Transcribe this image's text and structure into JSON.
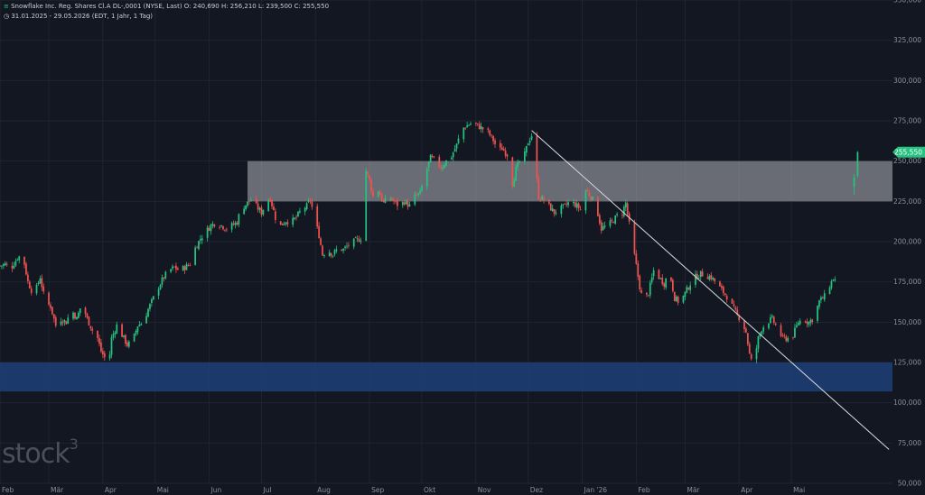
{
  "header": {
    "line1": "Snowflake Inc. Reg. Shares Cl.A DL-,0001 (NYSE, Last)",
    "ohlc": "O: 240,690   H: 256,210   L: 239,500   C: 255,550",
    "line2": "31.01.2025 - 29.05.2026   (EDT, 1 Jahr, 1 Tag)"
  },
  "watermark": {
    "text": "stock",
    "sup": "3"
  },
  "chart_data": {
    "type": "candlestick",
    "y_ticks": [
      50,
      75,
      100,
      125,
      150,
      175,
      200,
      225,
      250,
      275,
      300,
      325,
      350
    ],
    "y_tick_labels": [
      "50,000",
      "75,000",
      "100,000",
      "125,000",
      "150,000",
      "175,000",
      "200,000",
      "225,000",
      "250,000",
      "275,000",
      "300,000",
      "325,000",
      "350,000"
    ],
    "ylim": [
      50,
      350
    ],
    "x_labels": [
      "Feb",
      "Mär",
      "Apr",
      "Mai",
      "Jun",
      "Jul",
      "Aug",
      "Sep",
      "Okt",
      "Nov",
      "Dez",
      "Jan '26",
      "Feb",
      "Mär",
      "Apr",
      "Mai"
    ],
    "x_label_days": [
      0,
      28,
      59,
      89,
      120,
      150,
      181,
      212,
      242,
      273,
      303,
      334,
      365,
      393,
      424,
      454
    ],
    "x_range_days": [
      0,
      512
    ],
    "last_price_label": "255,550",
    "last_price": 255.55,
    "zones": [
      {
        "name": "resistance-zone",
        "from": 225,
        "to": 250,
        "start_day": 142,
        "color": "#b0b3b8"
      },
      {
        "name": "support-zone",
        "from": 107,
        "to": 125,
        "start_day": 0,
        "color": "#1e3f78"
      }
    ],
    "trendline": {
      "start_day": 305,
      "start_value": 269,
      "end_day": 510,
      "end_value": 71
    },
    "anchors": [
      [
        0,
        185
      ],
      [
        3,
        186
      ],
      [
        6,
        183
      ],
      [
        10,
        190
      ],
      [
        13,
        192
      ],
      [
        16,
        175
      ],
      [
        18,
        170
      ],
      [
        20,
        168
      ],
      [
        23,
        178
      ],
      [
        26,
        162
      ],
      [
        29,
        160
      ],
      [
        32,
        148
      ],
      [
        35,
        152
      ],
      [
        38,
        150
      ],
      [
        41,
        158
      ],
      [
        44,
        152
      ],
      [
        47,
        162
      ],
      [
        50,
        152
      ],
      [
        53,
        145
      ],
      [
        56,
        140
      ],
      [
        58,
        132
      ],
      [
        60,
        128
      ],
      [
        62,
        120
      ],
      [
        64,
        140
      ],
      [
        67,
        148
      ],
      [
        70,
        142
      ],
      [
        73,
        136
      ],
      [
        76,
        138
      ],
      [
        79,
        148
      ],
      [
        82,
        150
      ],
      [
        85,
        158
      ],
      [
        88,
        165
      ],
      [
        91,
        172
      ],
      [
        94,
        178
      ],
      [
        97,
        182
      ],
      [
        100,
        184
      ],
      [
        103,
        182
      ],
      [
        106,
        184
      ],
      [
        110,
        187
      ],
      [
        112,
        196
      ],
      [
        115,
        202
      ],
      [
        118,
        206
      ],
      [
        121,
        210
      ],
      [
        124,
        212
      ],
      [
        127,
        210
      ],
      [
        130,
        208
      ],
      [
        133,
        210
      ],
      [
        136,
        212
      ],
      [
        138,
        220
      ],
      [
        141,
        223
      ],
      [
        144,
        226
      ],
      [
        147,
        222
      ],
      [
        150,
        218
      ],
      [
        153,
        225
      ],
      [
        155,
        227
      ],
      [
        158,
        215
      ],
      [
        161,
        210
      ],
      [
        164,
        213
      ],
      [
        167,
        212
      ],
      [
        170,
        215
      ],
      [
        173,
        220
      ],
      [
        176,
        222
      ],
      [
        178,
        226
      ],
      [
        181,
        212
      ],
      [
        183,
        204
      ],
      [
        185,
        192
      ],
      [
        188,
        195
      ],
      [
        191,
        192
      ],
      [
        194,
        196
      ],
      [
        197,
        195
      ],
      [
        200,
        198
      ],
      [
        203,
        200
      ],
      [
        207,
        202
      ],
      [
        210,
        244
      ],
      [
        212,
        238
      ],
      [
        214,
        228
      ],
      [
        217,
        232
      ],
      [
        220,
        224
      ],
      [
        223,
        228
      ],
      [
        226,
        225
      ],
      [
        229,
        222
      ],
      [
        232,
        225
      ],
      [
        235,
        222
      ],
      [
        238,
        228
      ],
      [
        241,
        230
      ],
      [
        244,
        242
      ],
      [
        247,
        252
      ],
      [
        250,
        250
      ],
      [
        253,
        246
      ],
      [
        256,
        250
      ],
      [
        259,
        253
      ],
      [
        262,
        260
      ],
      [
        265,
        270
      ],
      [
        268,
        272
      ],
      [
        271,
        274
      ],
      [
        274,
        272
      ],
      [
        277,
        270
      ],
      [
        280,
        268
      ],
      [
        283,
        263
      ],
      [
        286,
        256
      ],
      [
        288,
        258
      ],
      [
        291,
        254
      ],
      [
        294,
        236
      ],
      [
        296,
        245
      ],
      [
        299,
        252
      ],
      [
        301,
        254
      ],
      [
        303,
        262
      ],
      [
        305,
        266
      ],
      [
        307,
        248
      ],
      [
        309,
        228
      ],
      [
        312,
        226
      ],
      [
        315,
        222
      ],
      [
        318,
        218
      ],
      [
        321,
        220
      ],
      [
        324,
        222
      ],
      [
        327,
        225
      ],
      [
        330,
        223
      ],
      [
        333,
        220
      ],
      [
        336,
        232
      ],
      [
        339,
        228
      ],
      [
        342,
        222
      ],
      [
        345,
        208
      ],
      [
        348,
        210
      ],
      [
        351,
        212
      ],
      [
        354,
        216
      ],
      [
        357,
        218
      ],
      [
        359,
        224
      ],
      [
        362,
        204
      ],
      [
        365,
        185
      ],
      [
        367,
        172
      ],
      [
        369,
        162
      ],
      [
        372,
        168
      ],
      [
        375,
        182
      ],
      [
        378,
        178
      ],
      [
        381,
        174
      ],
      [
        384,
        182
      ],
      [
        387,
        165
      ],
      [
        390,
        162
      ],
      [
        393,
        168
      ],
      [
        396,
        174
      ],
      [
        399,
        178
      ],
      [
        402,
        180
      ],
      [
        405,
        179
      ],
      [
        408,
        178
      ],
      [
        411,
        174
      ],
      [
        414,
        170
      ],
      [
        417,
        166
      ],
      [
        420,
        160
      ],
      [
        423,
        154
      ],
      [
        425,
        152
      ],
      [
        428,
        144
      ],
      [
        430,
        130
      ],
      [
        432,
        122
      ],
      [
        435,
        140
      ],
      [
        437,
        146
      ],
      [
        440,
        150
      ],
      [
        443,
        152
      ],
      [
        446,
        146
      ],
      [
        449,
        140
      ],
      [
        452,
        140
      ],
      [
        455,
        142
      ],
      [
        458,
        150
      ],
      [
        461,
        152
      ],
      [
        464,
        150
      ],
      [
        467,
        153
      ],
      [
        470,
        163
      ],
      [
        473,
        166
      ],
      [
        476,
        173
      ],
      [
        478,
        177
      ],
      [
        480,
        175
      ]
    ],
    "last_gap_day": 490,
    "last_day": 492,
    "last_bars": [
      {
        "day": 490,
        "o": 234,
        "h": 242,
        "l": 229,
        "c": 240
      },
      {
        "day": 492,
        "o": 240.69,
        "h": 256.21,
        "l": 239.5,
        "c": 255.55
      }
    ],
    "up_color": "#26c281",
    "down_color": "#ef5350"
  }
}
